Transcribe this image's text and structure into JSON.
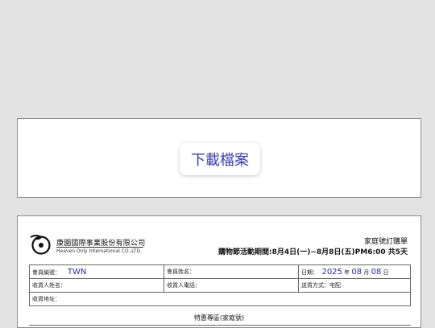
{
  "download": {
    "label": "下載檔案"
  },
  "document": {
    "company_zh": "康園國際事業股份有限公司",
    "company_en": "Heaven Only International CO.,LTD.",
    "title": "家庭號訂購單",
    "period": "購物節活動期間:8月4日(一)~8月8日(五)PM6:00 共5天",
    "fields": {
      "member_id_label": "會員編號：",
      "member_id_value": "TWN",
      "member_name_label": "會員姓名：",
      "date_label": "日期：",
      "date_year": "2025",
      "year_unit": "年",
      "date_month": "08",
      "month_unit": "月",
      "date_day": "08",
      "day_unit": "日",
      "recipient_label": "收貨人姓名：",
      "recipient_phone_label": "收貨人電話：",
      "delivery_label": "送貨方式：宅配",
      "address_label": "收貨地址："
    },
    "section_title": "特惠專區(家庭號)"
  },
  "colors": {
    "accent_blue": "#2a2ab0",
    "background": "#e3e3e3"
  }
}
